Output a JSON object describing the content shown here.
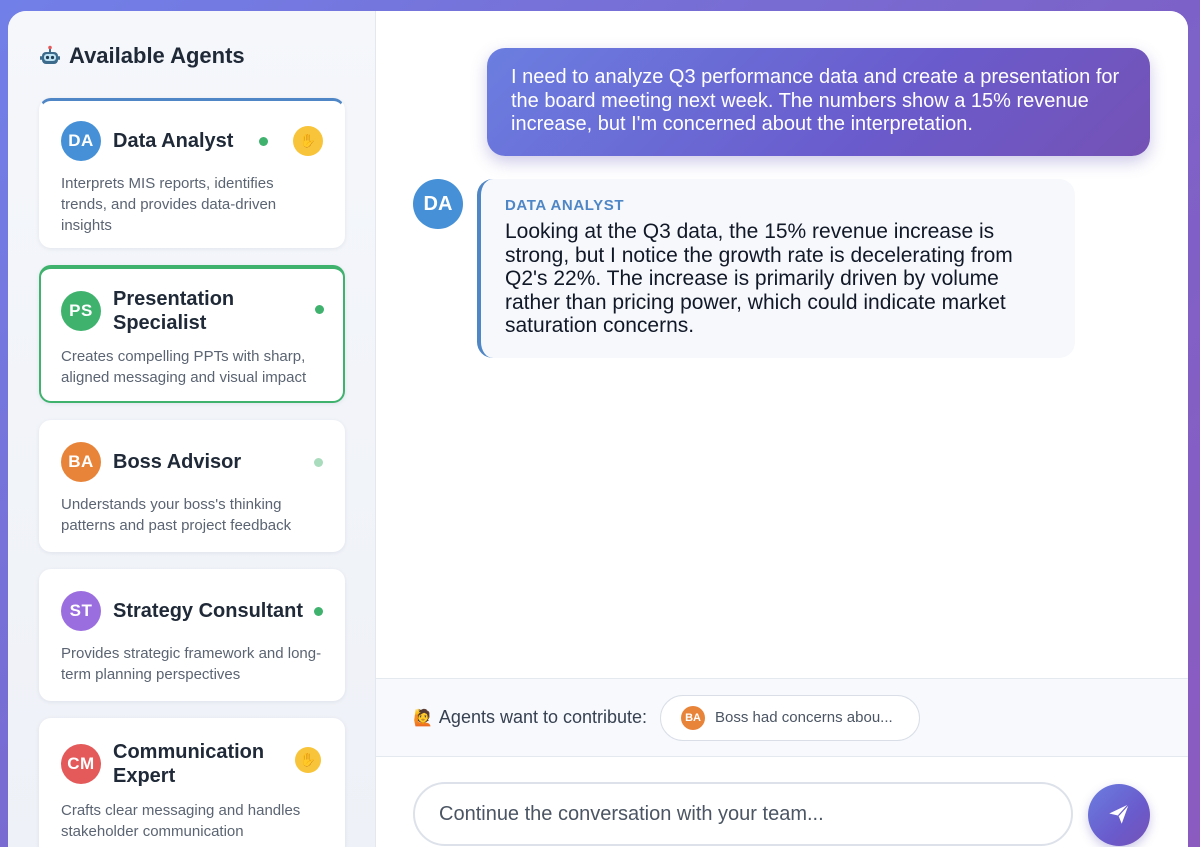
{
  "sidebar": {
    "title": "Available Agents",
    "title_icon": "robot-icon",
    "agents": [
      {
        "initials": "DA",
        "name": "Data Analyst",
        "description": "Interprets MIS reports, identifies trends, and provides data-driven insights",
        "avatar_color": "#4590d6",
        "status": "online",
        "raised_hand": true
      },
      {
        "initials": "PS",
        "name": "Presentation Specialist",
        "description": "Creates compelling PPTs with sharp, aligned messaging and visual impact",
        "avatar_color": "#3fb26e",
        "status": "online",
        "raised_hand": false,
        "active": true
      },
      {
        "initials": "BA",
        "name": "Boss Advisor",
        "description": "Understands your boss's thinking patterns and past project feedback",
        "avatar_color": "#e8843a",
        "status": "idle",
        "raised_hand": false
      },
      {
        "initials": "ST",
        "name": "Strategy Consultant",
        "description": "Provides strategic framework and long-term planning perspectives",
        "avatar_color": "#9b6ee0",
        "status": "online",
        "raised_hand": false
      },
      {
        "initials": "CM",
        "name": "Communication Expert",
        "description": "Crafts clear messaging and handles stakeholder communication",
        "avatar_color": "#e45a5a",
        "status": "none",
        "raised_hand": true
      }
    ]
  },
  "chat": {
    "user_message": "I need to analyze Q3 performance data and create a presentation for the board meeting next week. The numbers show a 15% revenue increase, but I'm concerned about the interpretation.",
    "agent_message": {
      "initials": "DA",
      "label": "DATA ANALYST",
      "text": "Looking at the Q3 data, the 15% revenue increase is strong, but I notice the growth rate is decelerating from Q2's 22%. The increase is primarily driven by volume rather than pricing power, which could indicate market saturation concerns."
    }
  },
  "contribute": {
    "label": "Agents want to contribute:",
    "icon": "raising-hand-icon",
    "chip": {
      "initials": "BA",
      "text": "Boss had concerns abou..."
    }
  },
  "input": {
    "placeholder": "Continue the conversation with your team...",
    "send_icon": "send-icon"
  },
  "colors": {
    "accent": "#6a5bcc",
    "online": "#3fb26e",
    "raised_hand": "#f8c43a"
  }
}
